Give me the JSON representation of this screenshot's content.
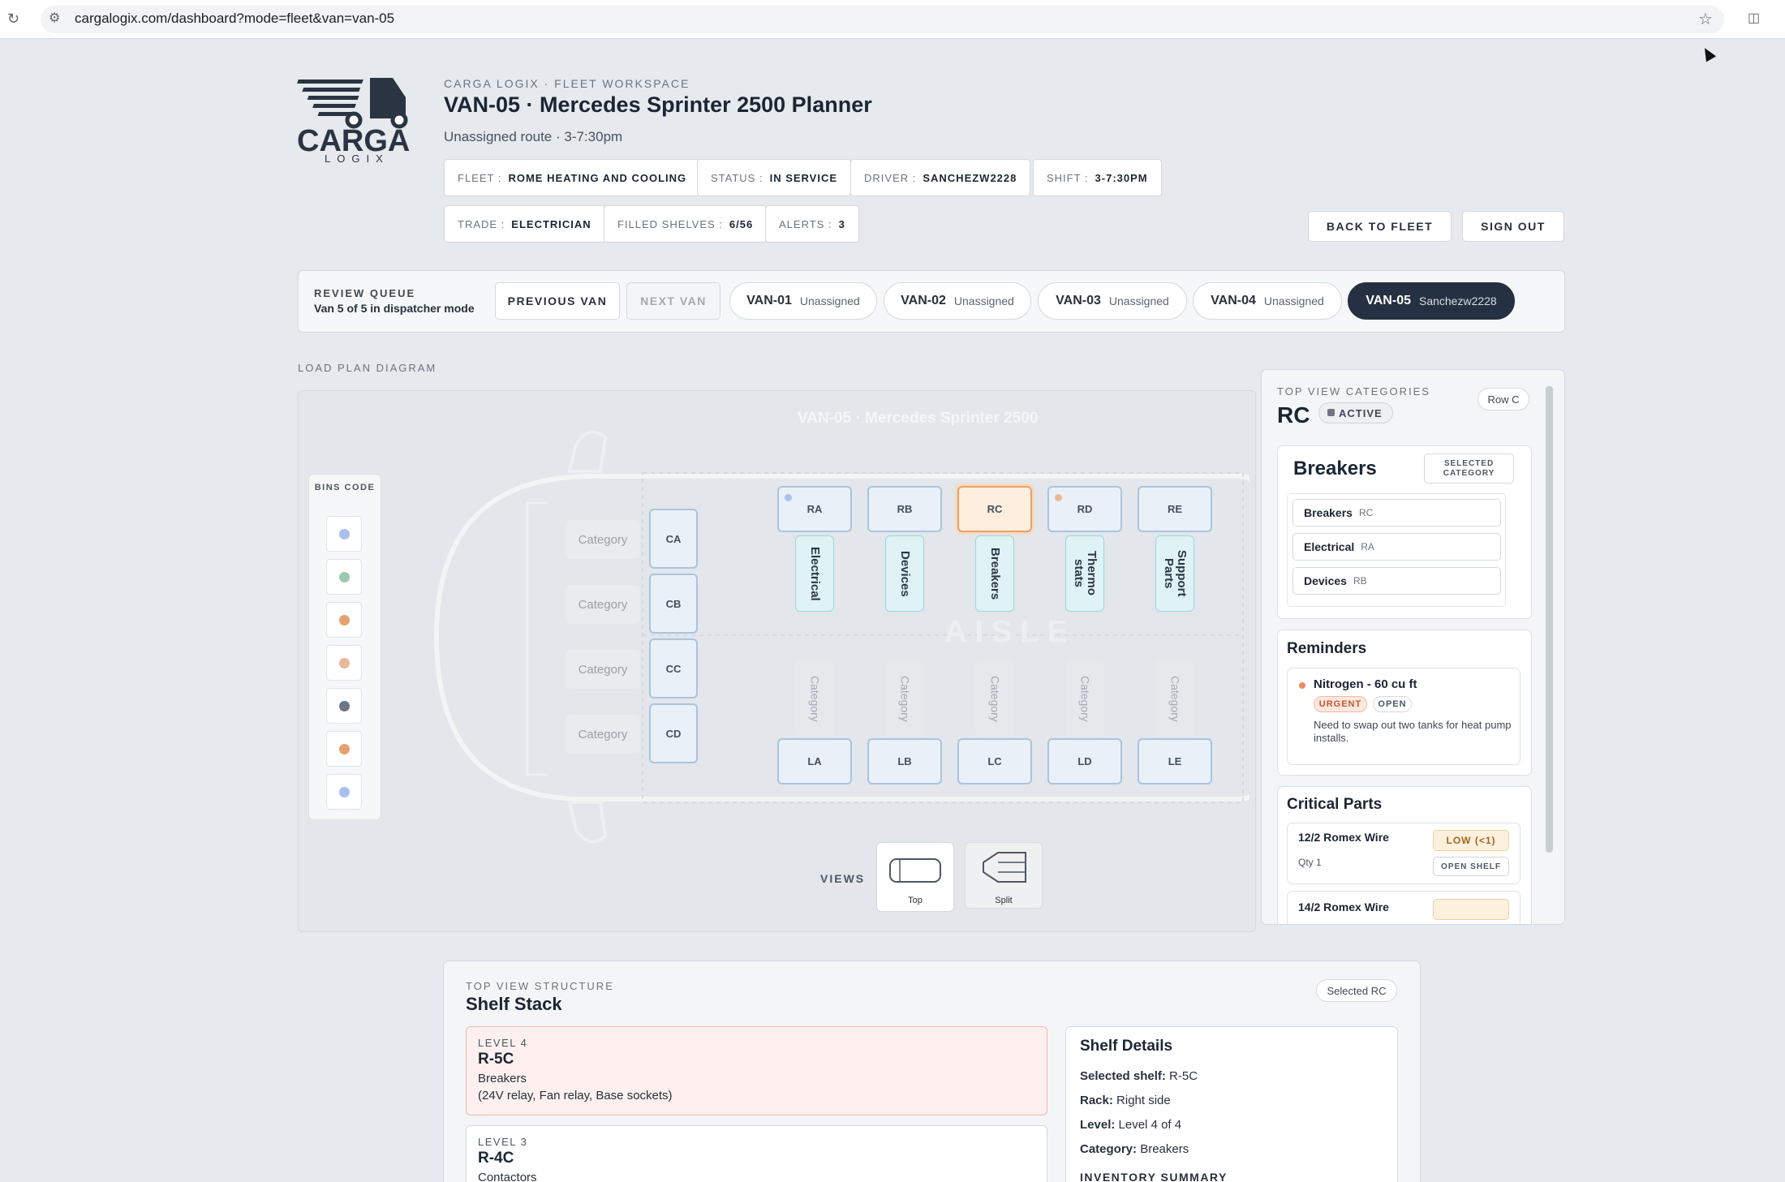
{
  "browser": {
    "url": "cargalogix.com/dashboard?mode=fleet&van=van-05"
  },
  "brand": {
    "logo_text": "CARGA",
    "logo_sub": "LOGIX"
  },
  "header": {
    "eyebrow": "CARGA LOGIX · FLEET WORKSPACE",
    "title": "VAN-05 · Mercedes Sprinter 2500 Planner",
    "subtitle": "Unassigned route · 3-7:30pm",
    "chips": [
      {
        "label": "FLEET :",
        "value": "ROME HEATING AND COOLING"
      },
      {
        "label": "STATUS :",
        "value": "IN SERVICE"
      },
      {
        "label": "DRIVER :",
        "value": "SANCHEZW2228"
      },
      {
        "label": "SHIFT :",
        "value": "3-7:30PM"
      },
      {
        "label": "TRADE :",
        "value": "ELECTRICIAN"
      },
      {
        "label": "FILLED SHELVES :",
        "value": "6/56"
      },
      {
        "label": "ALERTS :",
        "value": "3"
      }
    ],
    "back_button": "BACK TO FLEET",
    "signout_button": "SIGN OUT"
  },
  "queue": {
    "title": "REVIEW QUEUE",
    "subtitle": "Van 5 of 5 in dispatcher mode",
    "prev": "PREVIOUS VAN",
    "next": "NEXT VAN",
    "vans": [
      {
        "id": "VAN-01",
        "driver": "Unassigned"
      },
      {
        "id": "VAN-02",
        "driver": "Unassigned"
      },
      {
        "id": "VAN-03",
        "driver": "Unassigned"
      },
      {
        "id": "VAN-04",
        "driver": "Unassigned"
      },
      {
        "id": "VAN-05",
        "driver": "Sanchezw2228"
      }
    ]
  },
  "diagram": {
    "section_label": "LOAD PLAN DIAGRAM",
    "van_title": "VAN-05 · Mercedes Sprinter 2500",
    "aisle": "AISLE",
    "legend_title": "BINS CODE",
    "legend_colors": [
      "#a9bff0",
      "#9cc8b2",
      "#e6a170",
      "#e9b997",
      "#6e7682",
      "#e6a170",
      "#a9bff0"
    ],
    "right_bins": [
      "RA",
      "RB",
      "RC",
      "RD",
      "RE"
    ],
    "right_labels": [
      "Electrical",
      "Devices",
      "Breakers",
      "Thermo stats",
      "Support Parts"
    ],
    "left_bins": [
      "LA",
      "LB",
      "LC",
      "LD",
      "LE"
    ],
    "left_labels": [
      "Category",
      "Category",
      "Category",
      "Category",
      "Category"
    ],
    "cab_bins": [
      "CA",
      "CB",
      "CC",
      "CD"
    ],
    "cab_labels": [
      "Category",
      "Category",
      "Category",
      "Category"
    ],
    "views_label": "VIEWS",
    "views": [
      "Top",
      "Split"
    ]
  },
  "side": {
    "eyebrow": "TOP VIEW CATEGORIES",
    "row_badge": "Row C",
    "bin": "RC",
    "status": "ACTIVE",
    "category_title": "Breakers",
    "category_badge": "SELECTED CATEGORY",
    "categories": [
      {
        "name": "Breakers",
        "code": "RC"
      },
      {
        "name": "Electrical",
        "code": "RA"
      },
      {
        "name": "Devices",
        "code": "RB"
      }
    ],
    "reminders_title": "Reminders",
    "reminder": {
      "title": "Nitrogen - 60 cu ft",
      "tag1": "URGENT",
      "tag2": "OPEN",
      "text": "Need to swap out two tanks for heat pump installs."
    },
    "critical_title": "Critical Parts",
    "parts": [
      {
        "name": "12/2 Romex Wire",
        "qty": "Qty 1",
        "status": "LOW (<1)",
        "action": "OPEN SHELF"
      },
      {
        "name": "14/2 Romex Wire"
      }
    ]
  },
  "shelf": {
    "eyebrow": "TOP VIEW STRUCTURE",
    "title": "Shelf Stack",
    "badge": "Selected RC",
    "levels": [
      {
        "level": "LEVEL 4",
        "code": "R-5C",
        "category": "Breakers",
        "items": "(24V relay, Fan relay, Base sockets)"
      },
      {
        "level": "LEVEL 3",
        "code": "R-4C",
        "category": "Contactors"
      }
    ],
    "details_title": "Shelf Details",
    "details": [
      {
        "k": "Selected shelf:",
        "v": "R-5C"
      },
      {
        "k": "Rack:",
        "v": "Right side"
      },
      {
        "k": "Level:",
        "v": "Level 4 of 4"
      },
      {
        "k": "Category:",
        "v": "Breakers"
      }
    ],
    "summary_title": "INVENTORY SUMMARY"
  }
}
